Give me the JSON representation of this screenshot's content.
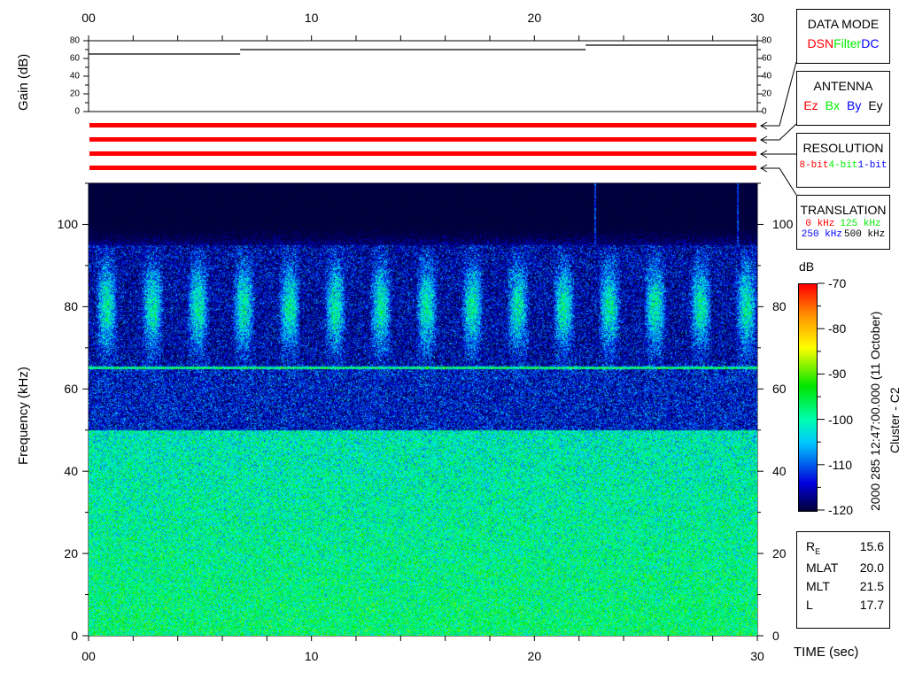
{
  "chart_data": [
    {
      "type": "line",
      "ylabel": "Gain (dB)",
      "xlim": [
        0,
        30
      ],
      "ylim": [
        0,
        80
      ],
      "x_ticks": [
        "00",
        "10",
        "20",
        "30"
      ],
      "y_ticks": [
        "0",
        "20",
        "40",
        "60",
        "80"
      ],
      "series": [
        {
          "segments": [
            {
              "x": [
                0,
                6.8
              ],
              "y": 65
            },
            {
              "x": 6.8,
              "x_end": 22.3,
              "y": 70
            },
            {
              "x": 22.3,
              "x_end": 30,
              "y": 75
            }
          ]
        }
      ]
    },
    {
      "type": "heatmap",
      "xlabel": "TIME (sec)",
      "ylabel": "Frequency (kHz)",
      "xlim": [
        0,
        30
      ],
      "ylim": [
        0,
        110
      ],
      "x_ticks": [
        "00",
        "10",
        "20",
        "30"
      ],
      "y_ticks": [
        "0",
        "20",
        "40",
        "60",
        "80",
        "100"
      ],
      "colorbar": {
        "label": "dB",
        "range": [
          -120,
          -70
        ],
        "ticks": [
          "-70",
          "-80",
          "-90",
          "-100",
          "-110",
          "-120"
        ]
      },
      "features": {
        "emission_band_khz": [
          50,
          95
        ],
        "narrowband_line_khz": 65,
        "background_below_khz": 50
      }
    }
  ],
  "status_bars": {
    "color": "#ff0000",
    "count": 4
  },
  "panels": {
    "data_mode": {
      "title": "DATA MODE",
      "items": [
        {
          "t": "DSN",
          "c": "#ff0000"
        },
        {
          "t": "Filter",
          "c": "#00ee00"
        },
        {
          "t": "DC",
          "c": "#0000ff"
        }
      ]
    },
    "antenna": {
      "title": "ANTENNA",
      "items": [
        {
          "t": "Ez",
          "c": "#ff0000"
        },
        {
          "t": "Bx",
          "c": "#00ee00"
        },
        {
          "t": "By",
          "c": "#0000ff"
        },
        {
          "t": "Ey",
          "c": "#000000"
        }
      ]
    },
    "resolution": {
      "title": "RESOLUTION",
      "items": [
        {
          "t": "8-bit",
          "c": "#ff0000"
        },
        {
          "t": "4-bit",
          "c": "#00ee00"
        },
        {
          "t": "1-bit",
          "c": "#0000ff"
        }
      ]
    },
    "translation": {
      "title": "TRANSLATION",
      "row1": [
        {
          "t": "0 kHz",
          "c": "#ff0000"
        },
        {
          "t": "125 kHz",
          "c": "#00ee00"
        }
      ],
      "row2": [
        {
          "t": "250 kHz",
          "c": "#0000ff"
        },
        {
          "t": "500 kHz",
          "c": "#000000"
        }
      ]
    }
  },
  "title_vertical": "2000 285 12:47:00.000 (11 October)",
  "spacecraft": "Cluster - C2",
  "info": [
    {
      "k": "R",
      "sub": "E",
      "v": "15.6"
    },
    {
      "k": "MLAT",
      "v": "20.0"
    },
    {
      "k": "MLT",
      "v": "21.5"
    },
    {
      "k": "L",
      "v": "17.7"
    }
  ],
  "time_label": "TIME (sec)"
}
